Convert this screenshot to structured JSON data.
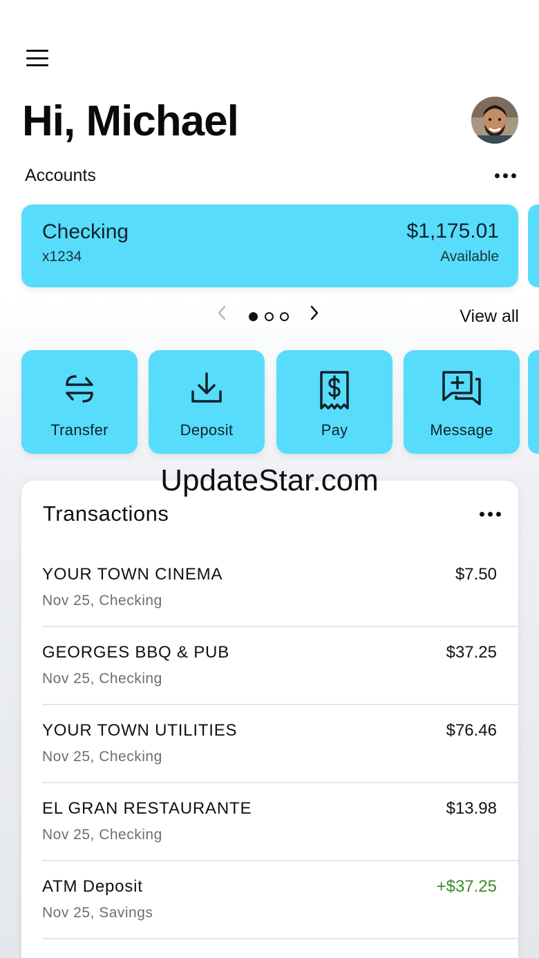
{
  "header": {
    "greeting": "Hi, Michael"
  },
  "accounts": {
    "label": "Accounts",
    "card": {
      "name": "Checking",
      "number": "x1234",
      "balance": "$1,175.01",
      "balance_label": "Available"
    },
    "pager": {
      "prev_icon": "chevron-left-icon",
      "next_icon": "chevron-right-icon",
      "total_pages": 3,
      "current_page": 1
    },
    "view_all": "View all"
  },
  "actions": [
    {
      "label": "Transfer",
      "icon": "transfer-arrows-icon"
    },
    {
      "label": "Deposit",
      "icon": "download-tray-icon"
    },
    {
      "label": "Pay",
      "icon": "dollar-receipt-icon"
    },
    {
      "label": "Message",
      "icon": "message-plus-icon"
    }
  ],
  "watermark": "UpdateStar.com",
  "transactions": {
    "title": "Transactions",
    "items": [
      {
        "merchant": "YOUR TOWN CINEMA",
        "meta": "Nov 25, Checking",
        "amount": "$7.50",
        "type": "debit"
      },
      {
        "merchant": "GEORGES BBQ & PUB",
        "meta": "Nov 25, Checking",
        "amount": "$37.25",
        "type": "debit"
      },
      {
        "merchant": "YOUR TOWN UTILITIES",
        "meta": "Nov 25, Checking",
        "amount": "$76.46",
        "type": "debit"
      },
      {
        "merchant": "EL GRAN RESTAURANTE",
        "meta": "Nov 25, Checking",
        "amount": "$13.98",
        "type": "debit"
      },
      {
        "merchant": "ATM Deposit",
        "meta": "Nov 25, Savings",
        "amount": "+$37.25",
        "type": "credit"
      }
    ]
  },
  "colors": {
    "accent": "#58dcfb",
    "credit": "#3c8a2b",
    "muted": "#6a6e73"
  }
}
